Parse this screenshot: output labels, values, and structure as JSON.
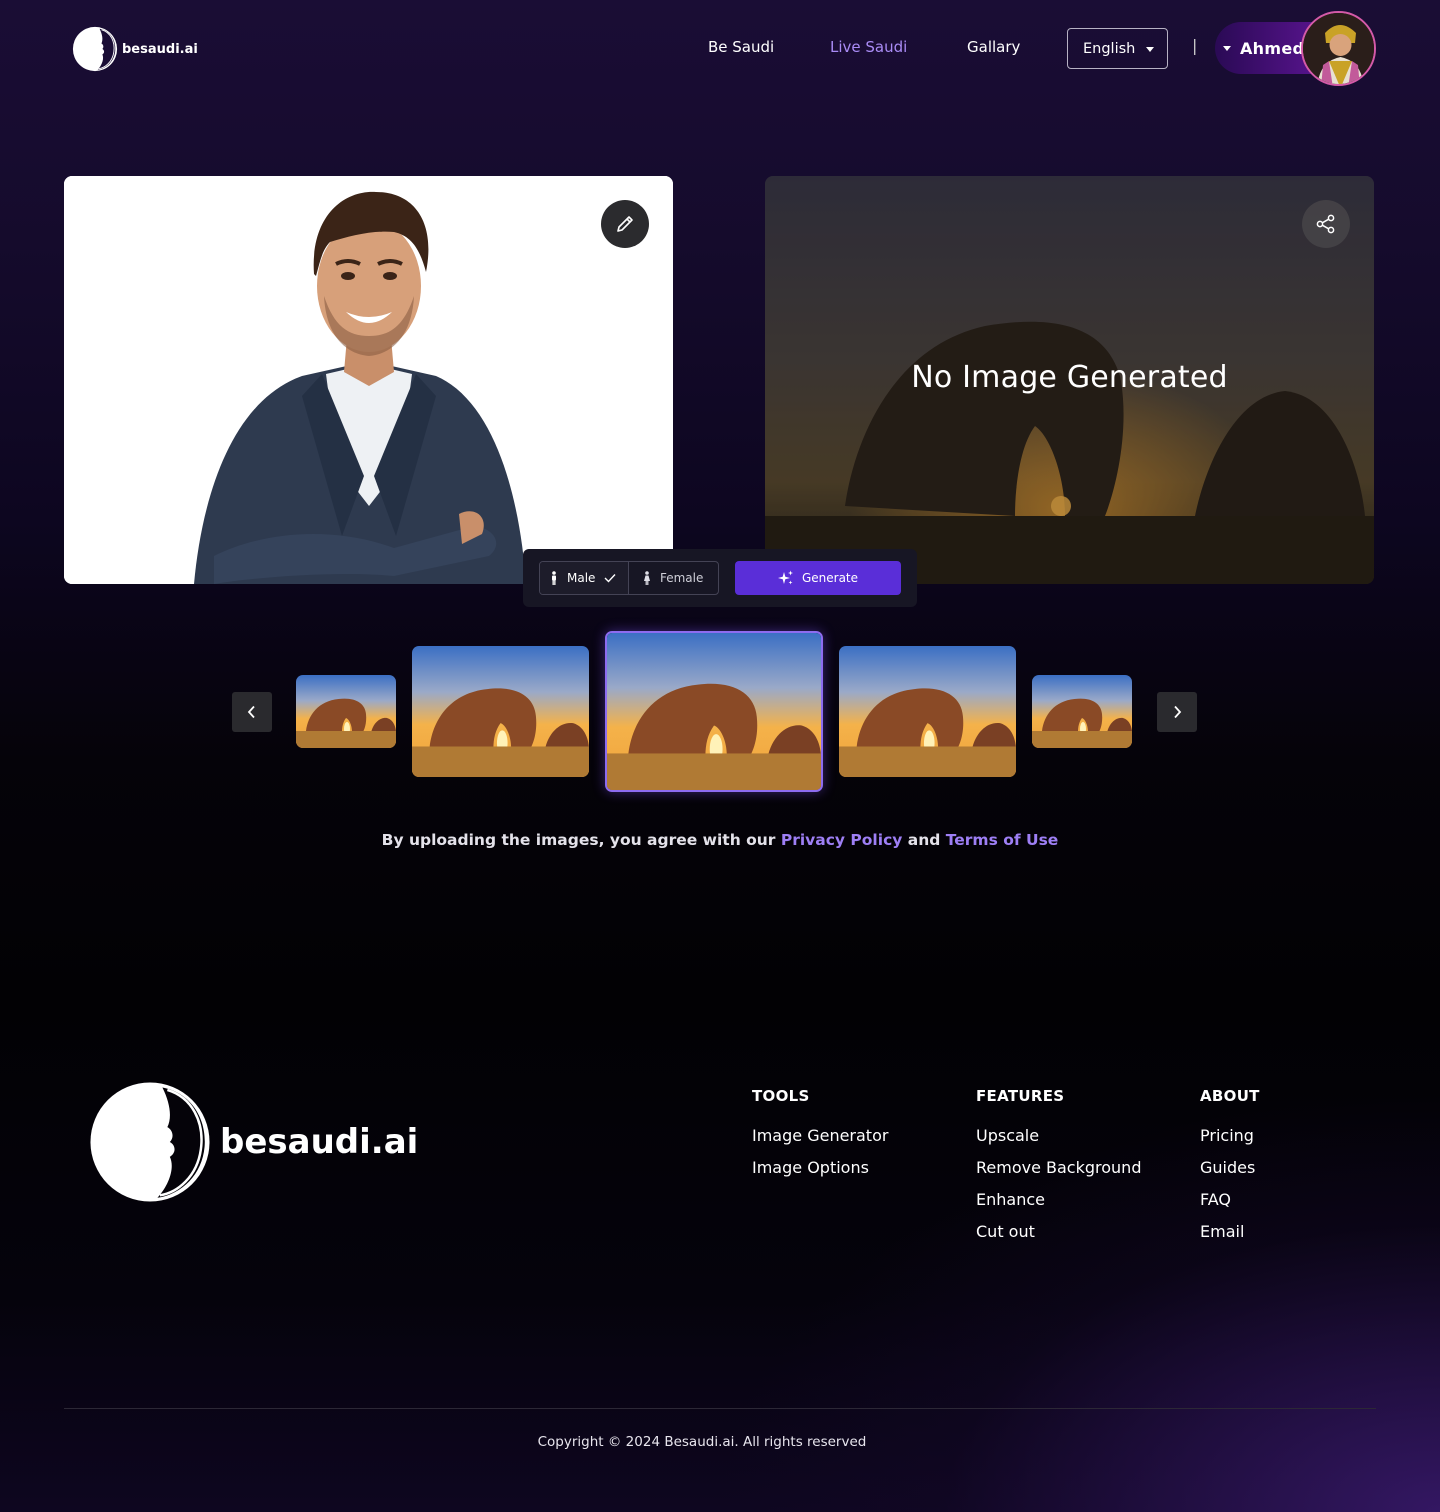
{
  "header": {
    "logo_text": "besaudi.ai",
    "nav": [
      "Be Saudi",
      "Live Saudi",
      "Gallary"
    ],
    "language": "English",
    "separator": "|",
    "user_name": "Ahmed"
  },
  "panels": {
    "generated_placeholder": "No Image Generated"
  },
  "controls": {
    "male_label": "Male",
    "female_label": "Female",
    "selected_gender": "Male",
    "generate_label": "Generate"
  },
  "carousel": {
    "selected_index": 2,
    "thumb_count": 5
  },
  "agreement": {
    "prefix": "By uploading the images, you agree with our",
    "privacy": "Privacy Policy",
    "and": "and",
    "terms": "Terms of Use"
  },
  "footer": {
    "logo_text": "besaudi.ai",
    "tools": {
      "heading": "TOOLS",
      "links": [
        "Image Generator",
        "Image Options"
      ]
    },
    "features": {
      "heading": "FEATURES",
      "links": [
        "Upscale",
        "Remove Background",
        "Enhance",
        "Cut out"
      ]
    },
    "about": {
      "heading": "ABOUT",
      "links": [
        "Pricing",
        "Guides",
        "FAQ",
        "Email"
      ]
    },
    "copyright": "Copyright © 2024 Besaudi.ai. All rights reserved"
  },
  "colors": {
    "accent": "#a98bf5",
    "generate_button": "#5a2ed8",
    "link": "#9e7ff5"
  }
}
